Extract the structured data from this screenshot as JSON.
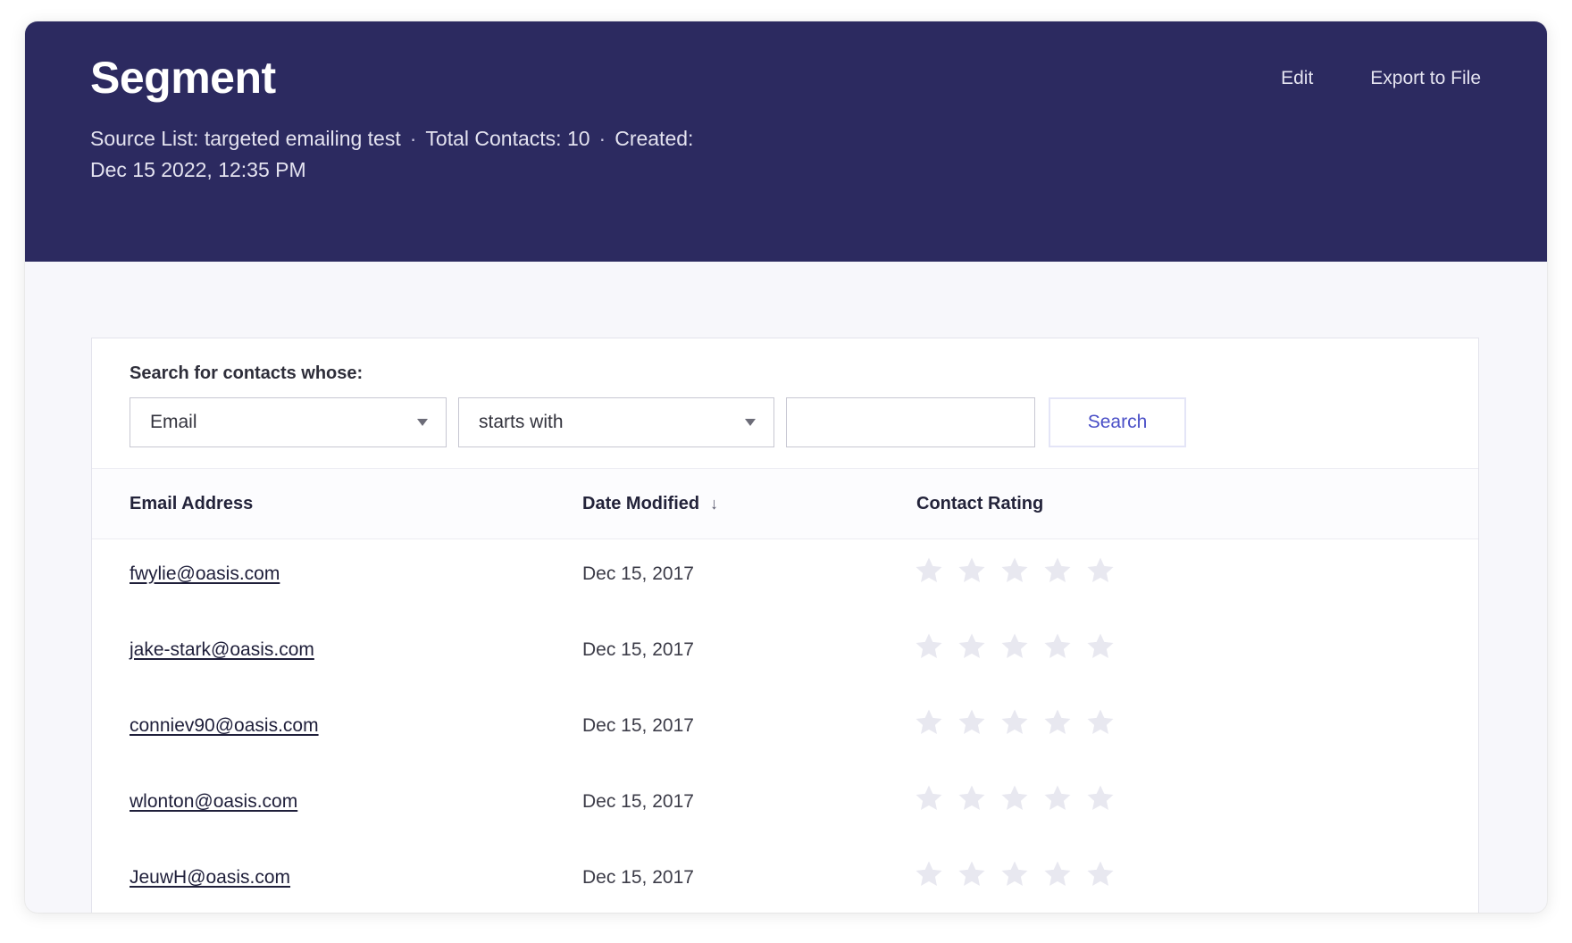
{
  "header": {
    "title": "Segment",
    "source_list": "Source List: targeted emailing test",
    "total_contacts": "Total Contacts: 10",
    "created_label": "Created:",
    "created_date": "Dec 15 2022, 12:35 PM",
    "separator": "·",
    "edit_label": "Edit",
    "export_label": "Export to File"
  },
  "search": {
    "label": "Search for contacts whose:",
    "field_value": "Email",
    "operator_value": "starts with",
    "query_value": "",
    "button_label": "Search"
  },
  "table": {
    "columns": {
      "email": "Email Address",
      "date": "Date Modified",
      "rating": "Contact Rating"
    },
    "sort_icon": "arrow-down-icon",
    "sort_glyph": "↓",
    "rows": [
      {
        "email": "fwylie@oasis.com",
        "date": "Dec 15, 2017",
        "rating": 0
      },
      {
        "email": "jake-stark@oasis.com",
        "date": "Dec 15, 2017",
        "rating": 0
      },
      {
        "email": "conniev90@oasis.com",
        "date": "Dec 15, 2017",
        "rating": 0
      },
      {
        "email": "wlonton@oasis.com",
        "date": "Dec 15, 2017",
        "rating": 0
      },
      {
        "email": "JeuwH@oasis.com",
        "date": "Dec 15, 2017",
        "rating": 0
      }
    ],
    "max_rating": 5
  },
  "colors": {
    "header_bg": "#2c2a60",
    "accent": "#4a4fc7",
    "star_empty": "#e8e8f0",
    "star_filled": "#f2b01e"
  }
}
